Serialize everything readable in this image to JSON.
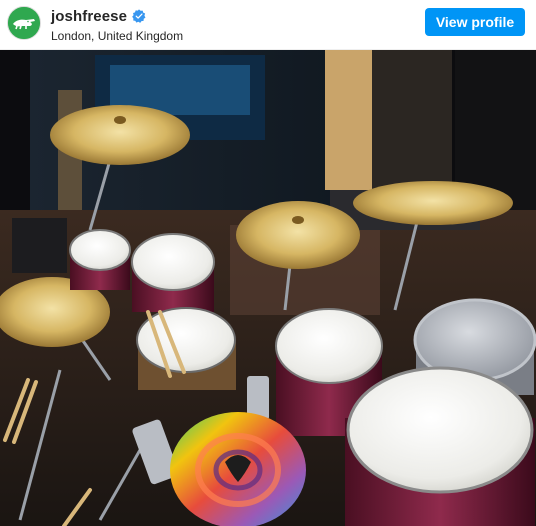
{
  "post": {
    "username": "joshfreese",
    "location": "London, United Kingdom",
    "view_profile_label": "View profile",
    "verified_icon": "verified-badge-icon",
    "avatar_icon": "alligator-logo-avatar",
    "photo_subject": "drum kit on stage"
  },
  "colors": {
    "button_blue": "#0095f6",
    "verified_blue": "#3897f0",
    "avatar_green": "#28a745"
  }
}
